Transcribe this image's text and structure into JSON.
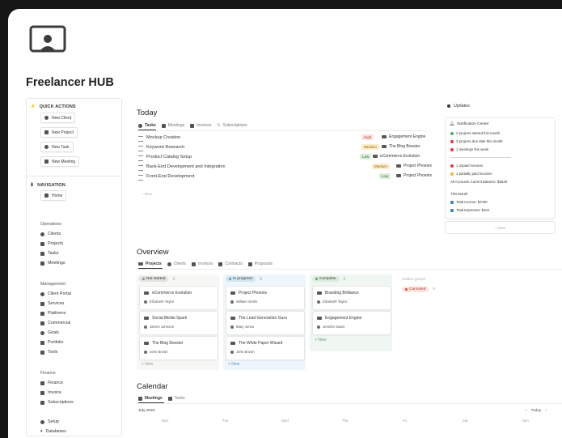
{
  "app": {
    "title": "Freelancer HUB"
  },
  "quick_actions": {
    "heading": "QUICK ACTIONS",
    "buttons": [
      "New Client",
      "New Project",
      "New Task",
      "New Meeting"
    ]
  },
  "navigation": {
    "heading": "NAVIGATION",
    "home": "Home",
    "groups": [
      {
        "title": "Operations",
        "items": [
          "Clients",
          "Projects",
          "Tasks",
          "Meetings"
        ]
      },
      {
        "title": "Management",
        "items": [
          "Client Portal",
          "Services",
          "Platforms",
          "Commercial",
          "Goals",
          "Portfolio",
          "Tools"
        ]
      },
      {
        "title": "Finance",
        "items": [
          "Finance",
          "Invoice",
          "Subscriptions"
        ]
      }
    ],
    "setup": "Setup",
    "databases": "Databases"
  },
  "today": {
    "title": "Today",
    "tabs": [
      "Tasks",
      "Meetings",
      "Invoices",
      "Subscriptions"
    ],
    "rows": [
      {
        "name": "Mockup Creation",
        "priority": "High",
        "project": "Engagement Engine"
      },
      {
        "name": "Keyword Research",
        "priority": "Medium",
        "project": "The Blog Booster"
      },
      {
        "name": "Product Catalog Setup",
        "priority": "Low",
        "project": "eCommerce Evolution"
      },
      {
        "name": "Back-End Development and Integration",
        "priority": "Medium",
        "project": "Project Phoenix"
      },
      {
        "name": "Front-End Development",
        "priority": "Low",
        "project": "Project Phoenix"
      }
    ],
    "new_label": "+ New"
  },
  "updates": {
    "title": "Updates",
    "notif_title": "Notification Center",
    "status_lines": [
      {
        "text": "2 projects started this month",
        "color": "#4caf50"
      },
      {
        "text": "3 projects due date this month",
        "color": "#e53935"
      },
      {
        "text": "1 meetings this week",
        "color": "#e53935"
      }
    ],
    "invoice_lines": [
      {
        "text": "1 unpaid invoices",
        "color": "#e53935"
      },
      {
        "text": "1 partially paid invoices",
        "color": "#f5b041"
      }
    ],
    "balance": "All Accounts Current Balance: $3648",
    "month_title": "This Month",
    "month_lines": [
      "Total Income: $3750",
      "Total Expenses: $102"
    ],
    "new_label": "+ New"
  },
  "overview": {
    "title": "Overview",
    "tabs": [
      "Projects",
      "Clients",
      "Invoices",
      "Contracts",
      "Proposals"
    ],
    "columns": [
      {
        "status": "Not started",
        "count": "3",
        "bg": "#f1f1ef",
        "pill_bg": "#e3e2e0",
        "dot": "#91918e",
        "cards": [
          {
            "name": "eCommerce Evolution",
            "person": "Elizabeth Taylor"
          },
          {
            "name": "Social Media Spark",
            "person": "James Johnson"
          },
          {
            "name": "The Blog Booster",
            "person": "John Brown"
          }
        ]
      },
      {
        "status": "In progress",
        "count": "3",
        "bg": "#eef5fb",
        "pill_bg": "#d3e5ef",
        "dot": "#5b97bd",
        "cards": [
          {
            "name": "Project Phoenix",
            "person": "William Smith"
          },
          {
            "name": "The Lead Generation Guru",
            "person": "Mary Jones"
          },
          {
            "name": "The White Paper Wizard",
            "person": "John Brown"
          }
        ]
      },
      {
        "status": "Complete",
        "count": "2",
        "bg": "#f0f6f1",
        "pill_bg": "#dbeddb",
        "dot": "#6c9b7d",
        "cards": [
          {
            "name": "Branding Brilliance",
            "person": "Elizabeth Taylor"
          },
          {
            "name": "Engagement Engine",
            "person": "Jennifer Davis"
          }
        ]
      }
    ],
    "hidden_groups": "Hidden groups",
    "canceled": {
      "label": "Canceled",
      "count": "0"
    },
    "new_label": "+ New"
  },
  "calendar": {
    "title": "Calendar",
    "tabs": [
      "Meetings",
      "Tasks"
    ],
    "month": "July 2024",
    "today_label": "Today",
    "days": [
      "Mon",
      "Tue",
      "Wed",
      "Thu",
      "Fri",
      "Sat",
      "Sun"
    ]
  }
}
